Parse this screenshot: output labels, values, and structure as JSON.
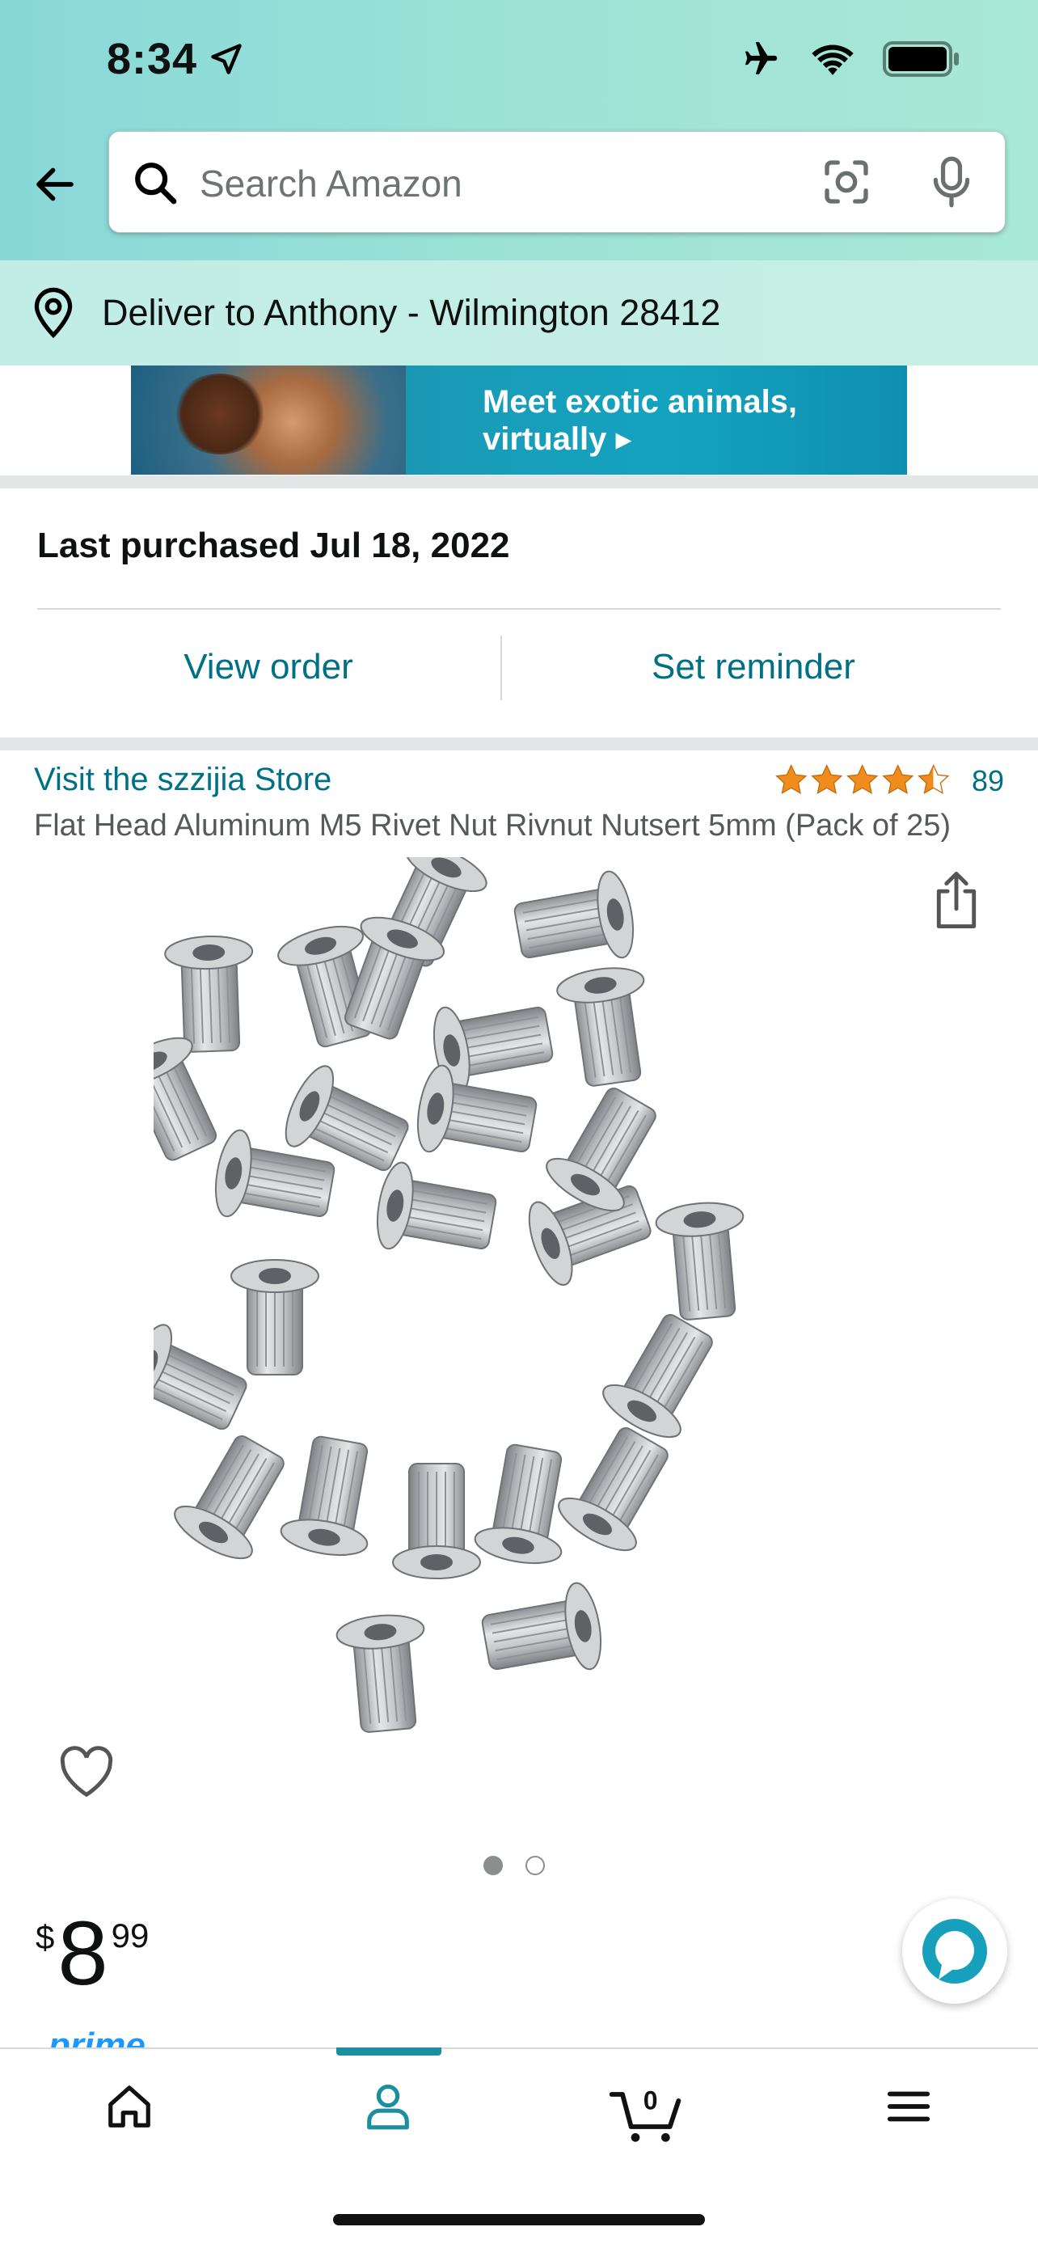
{
  "status_bar": {
    "time": "8:34"
  },
  "search": {
    "placeholder": "Search Amazon"
  },
  "delivery": {
    "text": "Deliver to Anthony - Wilmington 28412"
  },
  "banner": {
    "line1": "Meet exotic animals,",
    "line2": "virtually ▸"
  },
  "purchase": {
    "last_purchased": "Last purchased Jul 18, 2022",
    "view_order": "View order",
    "set_reminder": "Set reminder"
  },
  "product": {
    "store_link": "Visit the szzijia Store",
    "rating_stars": 4.5,
    "rating_count": "89",
    "title": "Flat Head Aluminum M5 Rivet Nut Rivnut Nutsert 5mm (Pack of 25)",
    "image_count": 2,
    "image_index": 1,
    "price_currency": "$",
    "price_whole": "8",
    "price_fraction": "99",
    "prime_label": "prime"
  },
  "nav": {
    "items": [
      "home-icon",
      "account-icon",
      "cart-icon",
      "menu-icon"
    ],
    "cart_count": "0",
    "active": "account"
  },
  "colors": {
    "link": "#007185",
    "star": "#f08c1c",
    "accent": "#1b8ea0"
  }
}
